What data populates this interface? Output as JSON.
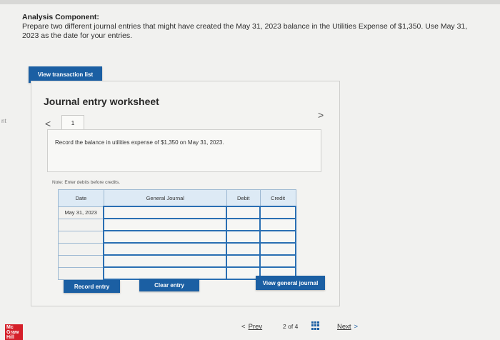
{
  "header": {
    "title": "Analysis Component:",
    "instructions": "Prepare two different journal entries that might have created the May 31, 2023 balance in the Utilities Expense of $1,350. Use May 31, 2023 as the date for your entries."
  },
  "margin_text": "nt",
  "buttons": {
    "view_transaction_list": "View transaction list",
    "record_entry": "Record entry",
    "clear_entry": "Clear entry",
    "view_general_journal": "View general journal"
  },
  "worksheet": {
    "title": "Journal entry worksheet",
    "prev_glyph": "<",
    "next_glyph": ">",
    "active_tab": "1",
    "description": "Record the balance in utilities expense of $1,350 on May 31, 2023.",
    "note": "Note: Enter debits before credits."
  },
  "journal": {
    "headers": {
      "date": "Date",
      "account": "General Journal",
      "debit": "Debit",
      "credit": "Credit"
    },
    "first_date": "May 31, 2023"
  },
  "footer": {
    "logo_line1": "Mc",
    "logo_line2": "Graw",
    "logo_line3": "Hill",
    "prev_glyph": "<",
    "prev_label": "Prev",
    "page_current": "2",
    "page_of": "of",
    "page_total": "4",
    "next_label": "Next",
    "next_glyph": ">"
  },
  "colors": {
    "accent": "#1b5fa3",
    "table_header": "#ddeaf5",
    "logo_red": "#d5202a"
  }
}
